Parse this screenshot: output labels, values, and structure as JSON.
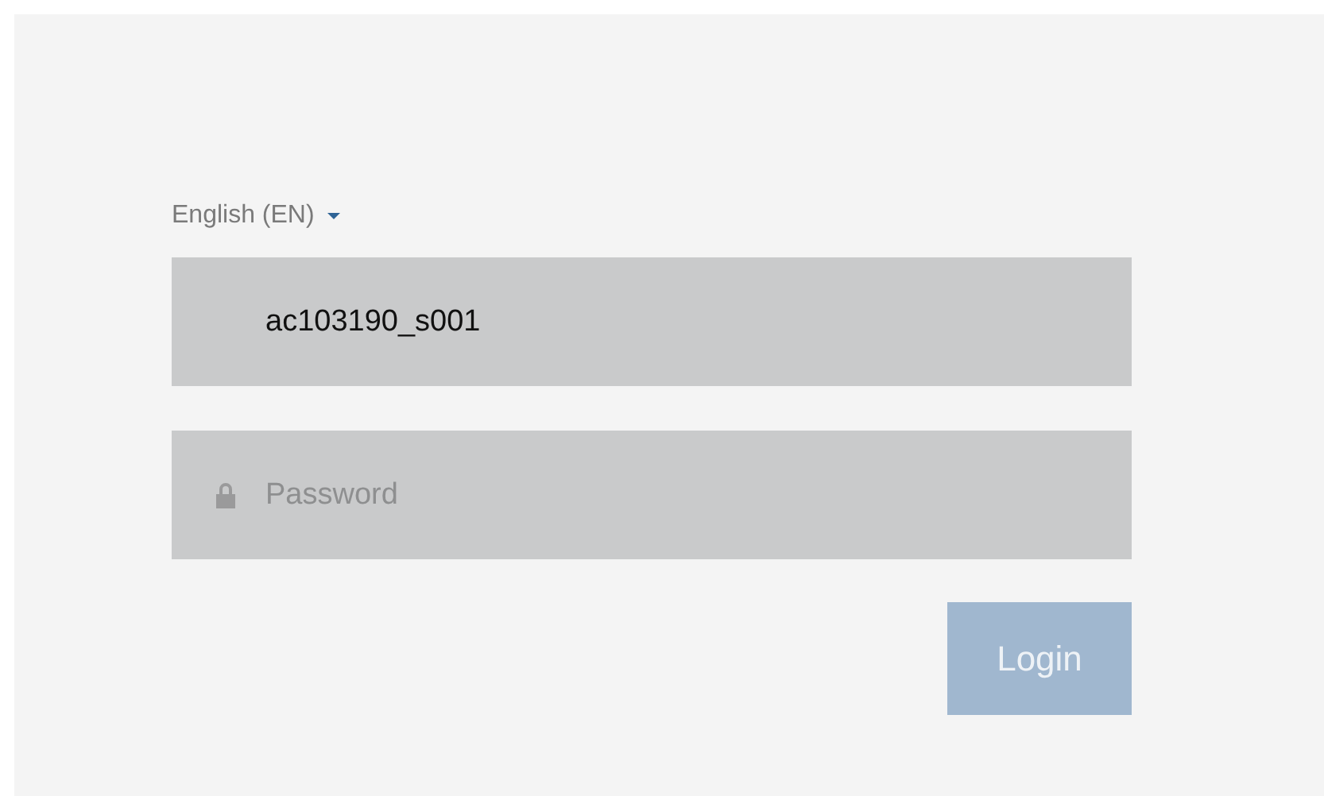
{
  "language": {
    "label": "English (EN)"
  },
  "username": {
    "value": "ac103190_s001"
  },
  "password": {
    "placeholder": "Password"
  },
  "login_button": {
    "label": "Login",
    "disabled": true
  }
}
